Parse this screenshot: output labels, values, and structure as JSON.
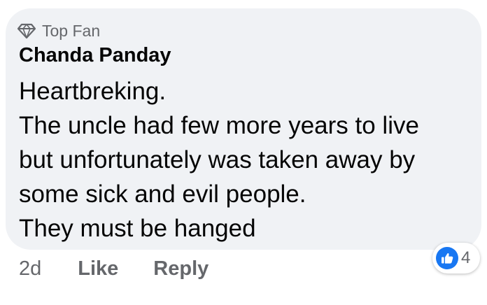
{
  "comment": {
    "badge": {
      "icon": "diamond-icon",
      "label": "Top Fan"
    },
    "author": "Chanda Panday",
    "lines": [
      "Heartbreking.",
      "The uncle had few more years to live",
      "but unfortunately was taken away by",
      "some sick and evil people.",
      "They must be hanged"
    ],
    "actions": {
      "time": "2d",
      "like_label": "Like",
      "reply_label": "Reply"
    },
    "reactions": {
      "icon": "thumbs-up-icon",
      "count": "4",
      "accent": "#1877f2"
    },
    "colors": {
      "bubble": "#f0f2f5",
      "secondary_text": "#65676b",
      "primary_text": "#050505"
    }
  }
}
